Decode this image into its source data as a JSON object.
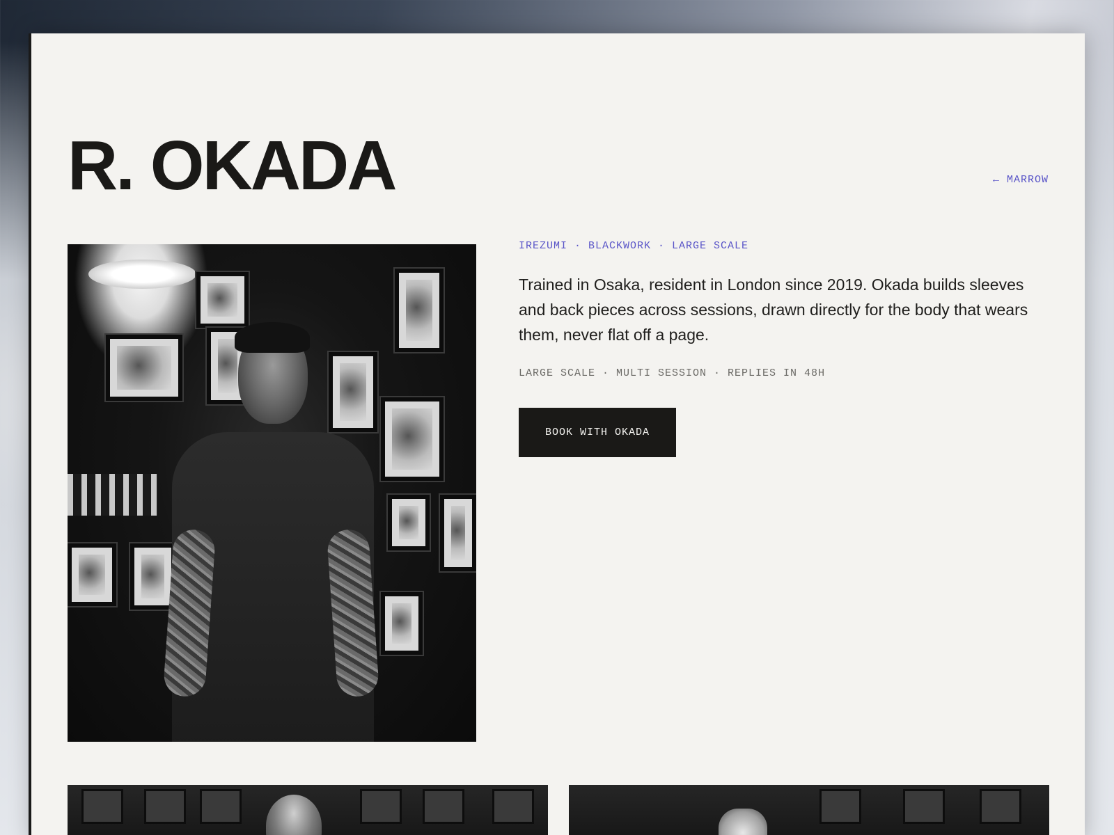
{
  "artist": {
    "name": "R. OKADA",
    "back_link": {
      "arrow": "←",
      "label": "MARROW"
    }
  },
  "profile": {
    "tags": "IREZUMI · BLACKWORK · LARGE SCALE",
    "bio": "Trained in Osaka, resident in London since 2019. Okada builds sleeves and back pieces across sessions, drawn directly for the body that wears them, never flat off a page.",
    "meta": "LARGE SCALE · MULTI SESSION · REPLIES IN 48H",
    "book_label": "BOOK WITH OKADA"
  },
  "colors": {
    "accent": "#5a55c8",
    "ink": "#1a1917",
    "paper": "#f4f3f0",
    "muted": "#6b6a66"
  }
}
